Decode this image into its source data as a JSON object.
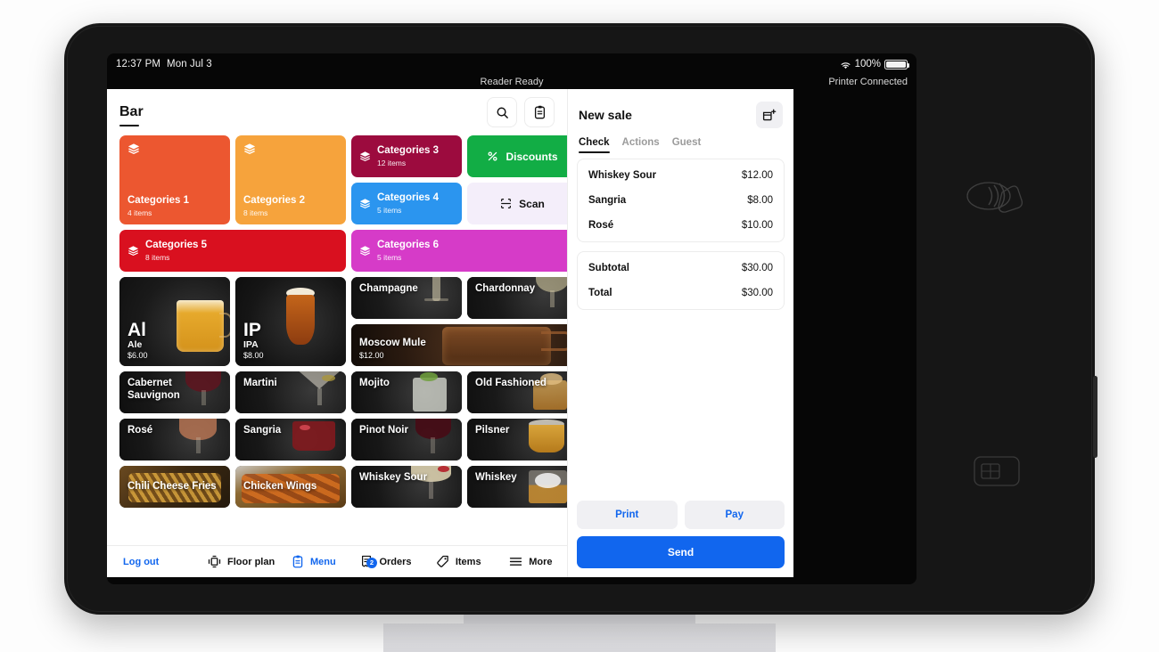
{
  "status_bar": {
    "time": "12:37 PM",
    "date": "Mon Jul 3",
    "battery_percent": "100%",
    "reader_status": "Reader Ready",
    "printer_status": "Printer Connected",
    "wifi_icon": "wifi-icon",
    "battery_icon": "battery-icon"
  },
  "left_panel": {
    "title": "Bar",
    "search_icon": "search-icon",
    "receipt_icon": "clipboard-icon",
    "categories": [
      {
        "name": "Categories 1",
        "items": "4 items",
        "color": "#ec5730",
        "size": "big"
      },
      {
        "name": "Categories 2",
        "items": "8 items",
        "color": "#f6a33c",
        "size": "big"
      },
      {
        "name": "Categories 3",
        "items": "12 items",
        "color": "#9c0b3e",
        "size": "small"
      },
      {
        "name": "Categories 4",
        "items": "5 items",
        "color": "#2b95ef",
        "size": "small"
      },
      {
        "name": "Categories 5",
        "items": "8 items",
        "color": "#d9101f",
        "size": "wide"
      },
      {
        "name": "Categories 6",
        "items": "5 items",
        "color": "#d63bc8",
        "size": "wide"
      }
    ],
    "discounts": {
      "label": "Discounts",
      "color": "#12ad45",
      "icon": "percent-icon"
    },
    "scan": {
      "label": "Scan",
      "color": "#f4eefa",
      "text_color": "#111111",
      "icon": "scan-icon"
    },
    "products": [
      {
        "abbr": "Al",
        "name": "Ale",
        "price": "$6.00",
        "image": "beer-mug"
      },
      {
        "abbr": "IP",
        "name": "IPA",
        "price": "$8.00",
        "image": "ipa-glass"
      },
      {
        "name": "Champagne",
        "image": "champagne-flute"
      },
      {
        "name": "Chardonnay",
        "image": "white-wine-glass"
      },
      {
        "name": "Moscow Mule",
        "price": "$12.00",
        "image": "copper-mug"
      },
      {
        "name": "Cabernet Sauvignon",
        "image": "red-wine-glass"
      },
      {
        "name": "Martini",
        "image": "martini-glass"
      },
      {
        "name": "Mojito",
        "image": "mojito-jar"
      },
      {
        "name": "Old Fashioned",
        "image": "old-fashioned-glass"
      },
      {
        "name": "Rosé",
        "image": "rose-wine-glass"
      },
      {
        "name": "Sangria",
        "image": "sangria-glass"
      },
      {
        "name": "Pinot Noir",
        "image": "pinot-noir-glass"
      },
      {
        "name": "Pilsner",
        "image": "pilsner-glass"
      },
      {
        "name": "Chili Cheese Fries",
        "image": "fries-plate"
      },
      {
        "name": "Chicken Wings",
        "image": "wings-plate"
      },
      {
        "name": "Whiskey Sour",
        "image": "whiskey-sour-coupe"
      },
      {
        "name": "Whiskey",
        "image": "whiskey-tumbler"
      }
    ]
  },
  "bottom_nav": [
    {
      "label": "Log out",
      "icon": "",
      "style": "link"
    },
    {
      "label": "Floor plan",
      "icon": "floorplan-icon",
      "style": "normal"
    },
    {
      "label": "Menu",
      "icon": "menu-board-icon",
      "style": "active"
    },
    {
      "label": "Orders",
      "icon": "orders-icon",
      "style": "normal",
      "badge": "2"
    },
    {
      "label": "Items",
      "icon": "tag-icon",
      "style": "normal"
    },
    {
      "label": "More",
      "icon": "hamburger-icon",
      "style": "normal"
    }
  ],
  "right_panel": {
    "title": "New sale",
    "new_sale_icon": "add-cart-icon",
    "tabs": [
      {
        "label": "Check",
        "selected": true
      },
      {
        "label": "Actions",
        "selected": false
      },
      {
        "label": "Guest",
        "selected": false
      }
    ],
    "line_items": [
      {
        "name": "Whiskey Sour",
        "amount": "$12.00"
      },
      {
        "name": "Sangria",
        "amount": "$8.00"
      },
      {
        "name": "Rosé",
        "amount": "$10.00"
      }
    ],
    "totals": [
      {
        "name": "Subtotal",
        "amount": "$30.00"
      },
      {
        "name": "Total",
        "amount": "$30.00"
      }
    ],
    "print_label": "Print",
    "pay_label": "Pay",
    "send_label": "Send",
    "accent_color": "#1166ee"
  },
  "device": {
    "contactless_icon": "contactless-payment-icon",
    "chip_icon": "chip-card-icon"
  }
}
